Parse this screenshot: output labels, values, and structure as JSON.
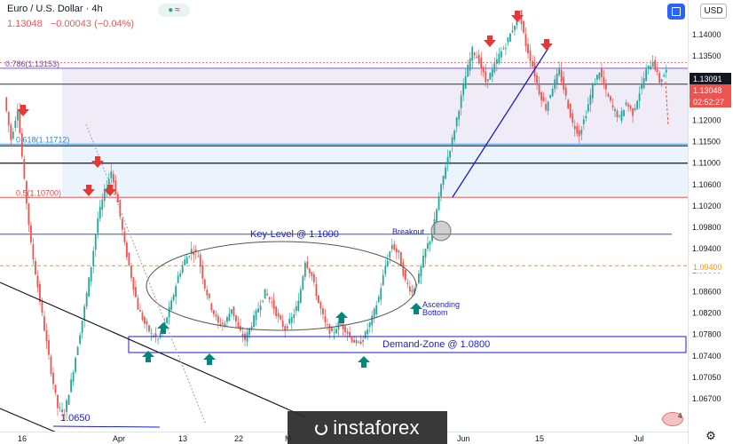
{
  "header": {
    "title": "Euro / U.S. Dollar · 4h",
    "price": "1.13048",
    "change": "−0.00043 (−0.04%)",
    "currency": "USD"
  },
  "price_tags": {
    "current": "1.13091",
    "last": "1.13048",
    "countdown": "02:52:27",
    "marked": "1.09400"
  },
  "watermark": "instaforex",
  "tv_label": "4",
  "colors": {
    "up": "#26a69a",
    "down": "#ef5350",
    "annotation": "#1c1ccc",
    "fib_top": "#e9e6f6",
    "fib_mid": "#e8f1fb",
    "level_red": "#ef5350",
    "level_orange": "#ff9800"
  },
  "chart_data": {
    "type": "candlestick",
    "symbol": "Euro / U.S. Dollar",
    "timeframe": "4h",
    "ylim": [
      1.0625,
      1.1445
    ],
    "y_ticks": [
      "1.14000",
      "1.13500",
      "1.13000",
      "1.12500",
      "1.12000",
      "1.11500",
      "1.11000",
      "1.10600",
      "1.10200",
      "1.09800",
      "1.09400",
      "1.09000",
      "1.08600",
      "1.08200",
      "1.07800",
      "1.07400",
      "1.07050",
      "1.06700"
    ],
    "x_ticks": [
      "16",
      "Apr",
      "13",
      "22",
      "M",
      "Jun",
      "15",
      "Jul"
    ],
    "levels": [
      {
        "label": "0.786(1.13153)",
        "value": 1.13153,
        "color": "#7e57c2"
      },
      {
        "label": "0.618(1.11712)",
        "value": 1.11712,
        "color": "#42a5f5"
      },
      {
        "label": "0.5(1.10700)",
        "value": 1.107,
        "color": "#ef5350"
      },
      {
        "label": "Key-Level @ 1.1000",
        "value": 1.1,
        "color": "#3f51b5"
      },
      {
        "label": "",
        "value": 1.094,
        "color": "#ff9800"
      }
    ],
    "zones": [
      {
        "label": "Demand-Zone @ 1.0800",
        "from": 1.0785,
        "to": 1.0805
      }
    ],
    "annotations": [
      "Key-Level @ 1.1000",
      "Breakout",
      "Ascending Bottom",
      "Demand-Zone @ 1.0800",
      "1.0650"
    ],
    "price_path": [
      1.126,
      1.118,
      1.124,
      1.11,
      1.098,
      1.09,
      1.082,
      1.074,
      1.067,
      1.066,
      1.072,
      1.079,
      1.086,
      1.094,
      1.103,
      1.108,
      1.112,
      1.106,
      1.098,
      1.092,
      1.086,
      1.083,
      1.081,
      1.08,
      1.083,
      1.087,
      1.092,
      1.095,
      1.097,
      1.096,
      1.09,
      1.086,
      1.083,
      1.083,
      1.086,
      1.082,
      1.08,
      1.083,
      1.086,
      1.089,
      1.087,
      1.084,
      1.082,
      1.084,
      1.087,
      1.095,
      1.092,
      1.087,
      1.083,
      1.081,
      1.083,
      1.082,
      1.08,
      1.079,
      1.081,
      1.084,
      1.088,
      1.094,
      1.098,
      1.096,
      1.091,
      1.089,
      1.092,
      1.097,
      1.1,
      1.107,
      1.113,
      1.118,
      1.124,
      1.13,
      1.135,
      1.133,
      1.129,
      1.131,
      1.134,
      1.136,
      1.139,
      1.142,
      1.136,
      1.132,
      1.127,
      1.124,
      1.128,
      1.131,
      1.126,
      1.121,
      1.119,
      1.123,
      1.128,
      1.131,
      1.127,
      1.124,
      1.122,
      1.125,
      1.123,
      1.127,
      1.131,
      1.133,
      1.129,
      1.131
    ]
  }
}
